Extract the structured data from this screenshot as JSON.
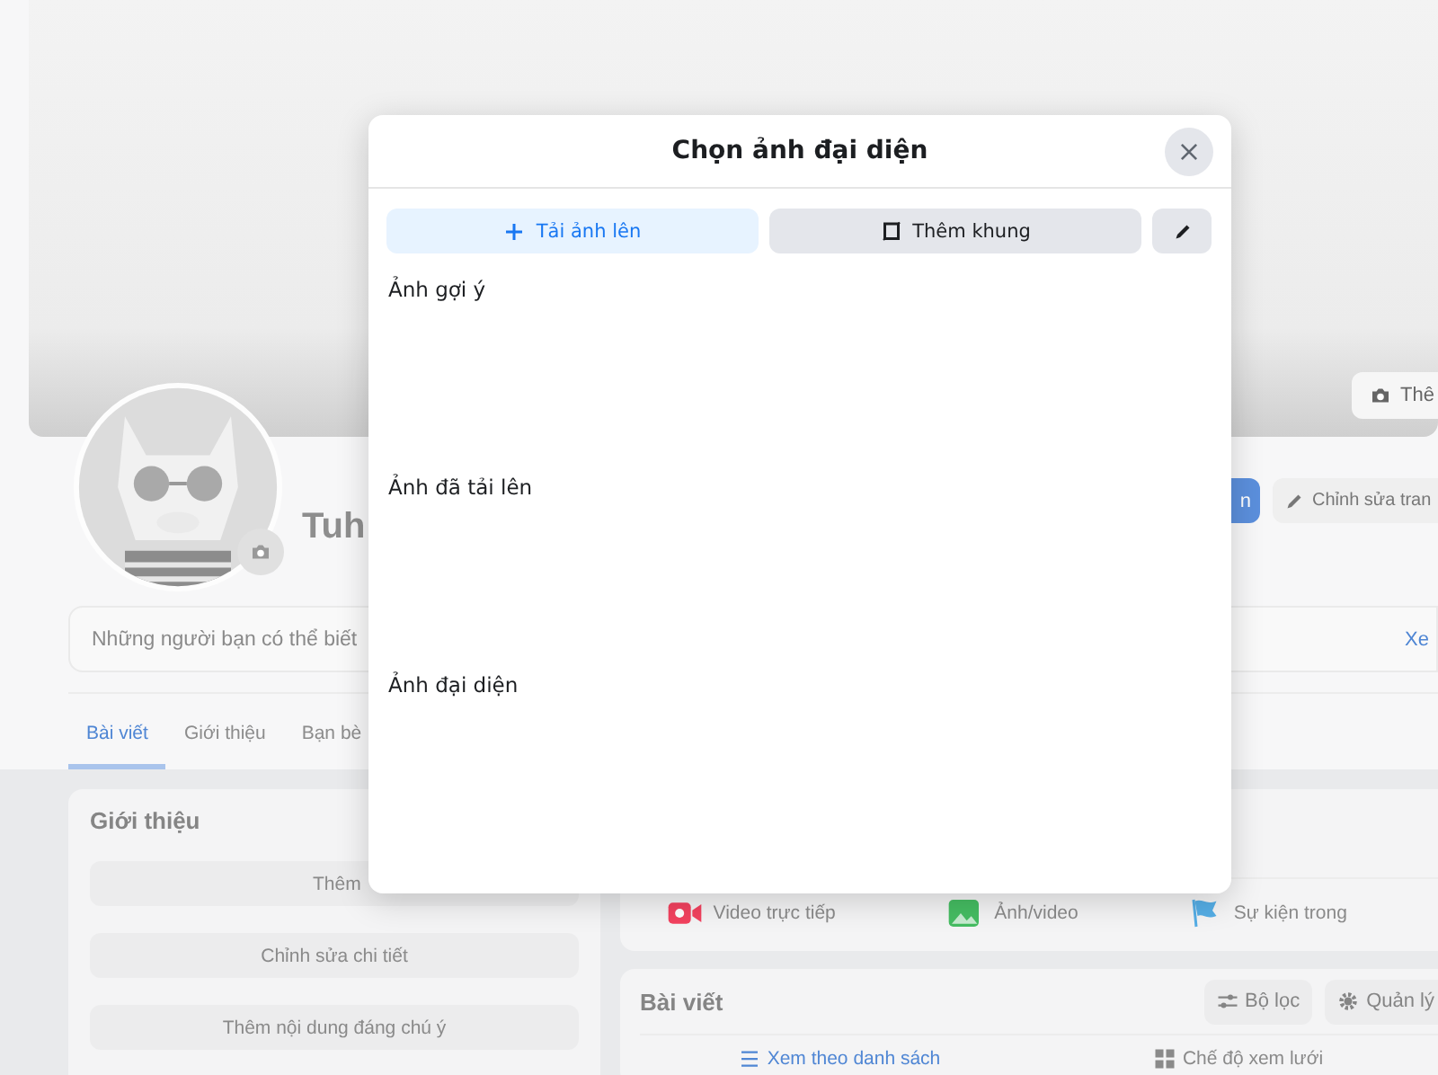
{
  "profile_page": {
    "cover": {
      "button": "Thê"
    },
    "profile": {
      "name": "Tuh",
      "buttons": [
        {
          "label": "n",
          "kind": "primary"
        },
        {
          "label": "Chỉnh sửa tran",
          "kind": "edit"
        }
      ]
    },
    "friends_suggestion": {
      "text": "Những người bạn có thể biết",
      "link": "Xe"
    },
    "tabs": [
      {
        "label": "Bài viết",
        "selected": true
      },
      {
        "label": "Giới thiệu",
        "selected": false
      },
      {
        "label": "Bạn bè",
        "selected": false
      }
    ],
    "intro": {
      "title": "Giới thiệu",
      "buttons": [
        {
          "label": "Thêm",
          "kind": "cut"
        },
        {
          "label": "Chỉnh sửa chi tiết",
          "kind": "full"
        },
        {
          "label": "Thêm nội dung đáng chú ý",
          "kind": "full"
        }
      ]
    },
    "composer": {
      "actions": [
        {
          "label": "Video trực tiếp",
          "kind": "live"
        },
        {
          "label": "Ảnh/video"
        },
        {
          "label": "Sự kiện trong",
          "kind": "event"
        }
      ]
    },
    "posts": {
      "title": "Bài viết",
      "buttons": [
        {
          "label": "Bộ lọc",
          "kind": "filter"
        },
        {
          "label": "Quản lý",
          "kind": "manage"
        }
      ],
      "views": [
        {
          "label": "Xem theo danh sách",
          "kind": "list",
          "selected": true
        },
        {
          "label": "Chế độ xem lưới",
          "kind": "grid",
          "selected": false
        }
      ]
    }
  },
  "dialog": {
    "title": "Chọn ảnh đại diện",
    "actions": [
      {
        "label": "Tải ảnh lên",
        "kind": "upload"
      },
      {
        "label": "Thêm khung",
        "kind": "frame"
      },
      {
        "kind": "edit"
      }
    ],
    "sections": [
      "Ảnh gợi ý",
      "Ảnh đã tải lên",
      "Ảnh đại diện"
    ]
  }
}
